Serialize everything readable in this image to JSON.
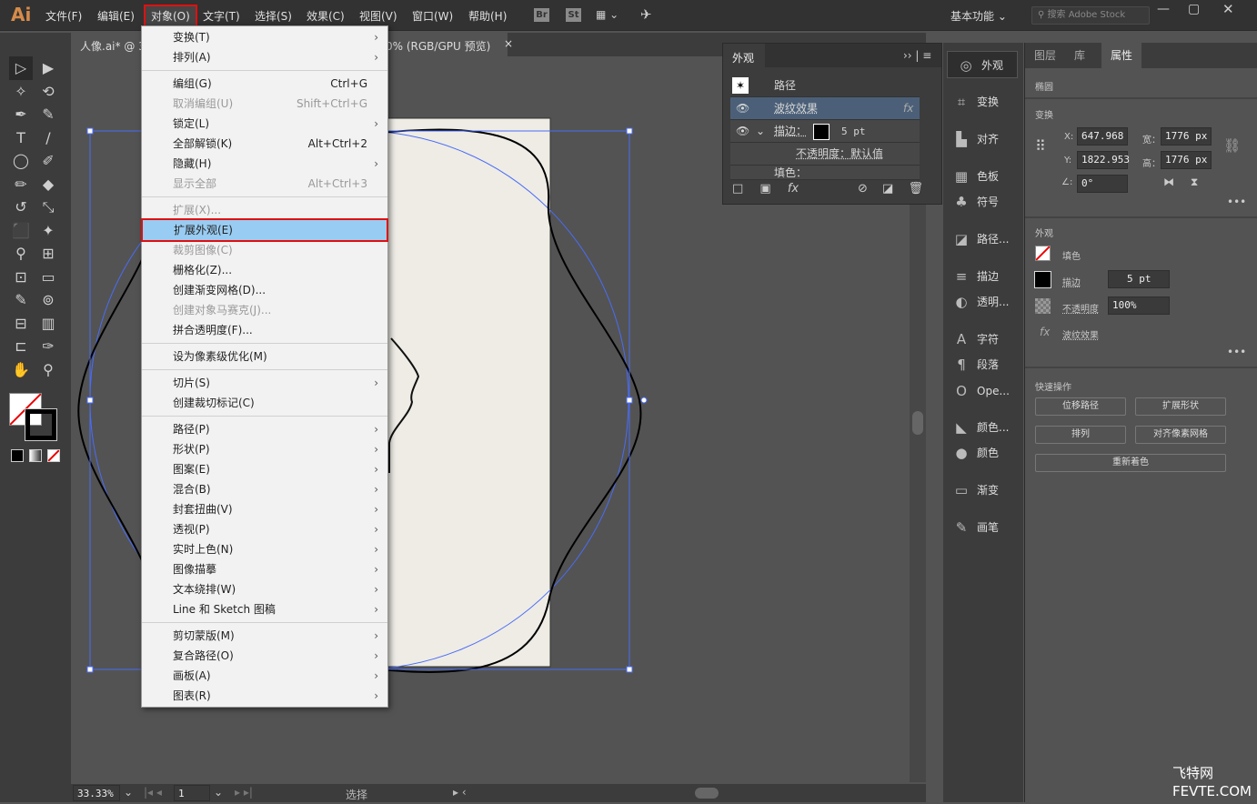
{
  "app": {
    "logo": "Ai",
    "workspace": "基本功能",
    "search_placeholder": "搜索 Adobe Stock",
    "bridge": "Br",
    "stock": "St"
  },
  "menubar": [
    "文件(F)",
    "编辑(E)",
    "对象(O)",
    "文字(T)",
    "选择(S)",
    "效果(C)",
    "视图(V)",
    "窗口(W)",
    "帮助(H)"
  ],
  "document_tab": {
    "title_left": "人像.ai* @ 3",
    "title_right": "0% (RGB/GPU 预览)"
  },
  "object_menu": [
    {
      "label": "变换(T)",
      "sub": true
    },
    {
      "label": "排列(A)",
      "sub": true
    },
    {
      "sep": true
    },
    {
      "label": "编组(G)",
      "shortcut": "Ctrl+G"
    },
    {
      "label": "取消编组(U)",
      "shortcut": "Shift+Ctrl+G",
      "disabled": true
    },
    {
      "label": "锁定(L)",
      "sub": true
    },
    {
      "label": "全部解锁(K)",
      "shortcut": "Alt+Ctrl+2"
    },
    {
      "label": "隐藏(H)",
      "sub": true
    },
    {
      "label": "显示全部",
      "shortcut": "Alt+Ctrl+3",
      "disabled": true
    },
    {
      "sep": true
    },
    {
      "label": "扩展(X)...",
      "disabled": true
    },
    {
      "label": "扩展外观(E)",
      "highlighted": true
    },
    {
      "label": "裁剪图像(C)",
      "disabled": true
    },
    {
      "label": "栅格化(Z)..."
    },
    {
      "label": "创建渐变网格(D)..."
    },
    {
      "label": "创建对象马赛克(J)...",
      "disabled": true
    },
    {
      "label": "拼合透明度(F)..."
    },
    {
      "sep": true
    },
    {
      "label": "设为像素级优化(M)"
    },
    {
      "sep": true
    },
    {
      "label": "切片(S)",
      "sub": true
    },
    {
      "label": "创建裁切标记(C)"
    },
    {
      "sep": true
    },
    {
      "label": "路径(P)",
      "sub": true
    },
    {
      "label": "形状(P)",
      "sub": true
    },
    {
      "label": "图案(E)",
      "sub": true
    },
    {
      "label": "混合(B)",
      "sub": true
    },
    {
      "label": "封套扭曲(V)",
      "sub": true
    },
    {
      "label": "透视(P)",
      "sub": true
    },
    {
      "label": "实时上色(N)",
      "sub": true
    },
    {
      "label": "图像描摹",
      "sub": true
    },
    {
      "label": "文本绕排(W)",
      "sub": true
    },
    {
      "label": "Line 和 Sketch 图稿",
      "sub": true
    },
    {
      "sep": true
    },
    {
      "label": "剪切蒙版(M)",
      "sub": true
    },
    {
      "label": "复合路径(O)",
      "sub": true
    },
    {
      "label": "画板(A)",
      "sub": true
    },
    {
      "label": "图表(R)",
      "sub": true
    }
  ],
  "appearance_panel": {
    "tab": "外观",
    "object": "路径",
    "effect": "波纹效果",
    "stroke_label": "描边：",
    "stroke_value": "5 pt",
    "opacity": "不透明度：默认值",
    "fill_label": "填色："
  },
  "dock": [
    {
      "icon": "appearance-icon",
      "glyph": "◎",
      "label": "外观"
    },
    {
      "icon": "transform-icon",
      "glyph": "⌗",
      "label": "变换"
    },
    {
      "icon": "align-icon",
      "glyph": "▙",
      "label": "对齐"
    },
    {
      "icon": "swatches-icon",
      "glyph": "▦",
      "label": "色板"
    },
    {
      "icon": "symbols-icon",
      "glyph": "♣",
      "label": "符号"
    },
    {
      "icon": "pathfinder-icon",
      "glyph": "◪",
      "label": "路径..."
    },
    {
      "icon": "stroke-icon",
      "glyph": "≡",
      "label": "描边"
    },
    {
      "icon": "transparency-icon",
      "glyph": "◐",
      "label": "透明..."
    },
    {
      "icon": "character-icon",
      "glyph": "A",
      "label": "字符"
    },
    {
      "icon": "paragraph-icon",
      "glyph": "¶",
      "label": "段落"
    },
    {
      "icon": "opentype-icon",
      "glyph": "O",
      "label": "Ope..."
    },
    {
      "icon": "color-guide-icon",
      "glyph": "◣",
      "label": "颜色..."
    },
    {
      "icon": "color-icon",
      "glyph": "●",
      "label": "颜色"
    },
    {
      "icon": "gradient-icon",
      "glyph": "▭",
      "label": "渐变"
    },
    {
      "icon": "brushes-icon",
      "glyph": "✎",
      "label": "画笔"
    }
  ],
  "properties": {
    "tabs": [
      "图层",
      "库",
      "属性"
    ],
    "active_tab": "属性",
    "object_type": "椭圆",
    "transform_title": "变换",
    "x_label": "X:",
    "x": "647.968",
    "y_label": "Y:",
    "y": "1822.953",
    "w_label": "宽：",
    "w": "1776 px",
    "h_label": "高：",
    "h": "1776 px",
    "angle": "0°",
    "appearance_title": "外观",
    "fill": "填色",
    "stroke": "描边",
    "stroke_weight": "5 pt",
    "opacity_label": "不透明度",
    "opacity": "100%",
    "effect": "波纹效果",
    "quick_title": "快速操作",
    "quick": [
      "位移路径",
      "扩展形状",
      "排列",
      "对齐像素网格",
      "重新着色"
    ]
  },
  "status": {
    "zoom": "33.33%",
    "artboard": "1",
    "tool": "选择"
  },
  "watermark": {
    "line1": "飞特网",
    "line2": "FEVTE.COM"
  },
  "colors": {
    "accent_highlight": "#99ccf2",
    "menu_outline": "#e01010",
    "selection": "#4a6cf7",
    "artboard": "#eeece5"
  }
}
